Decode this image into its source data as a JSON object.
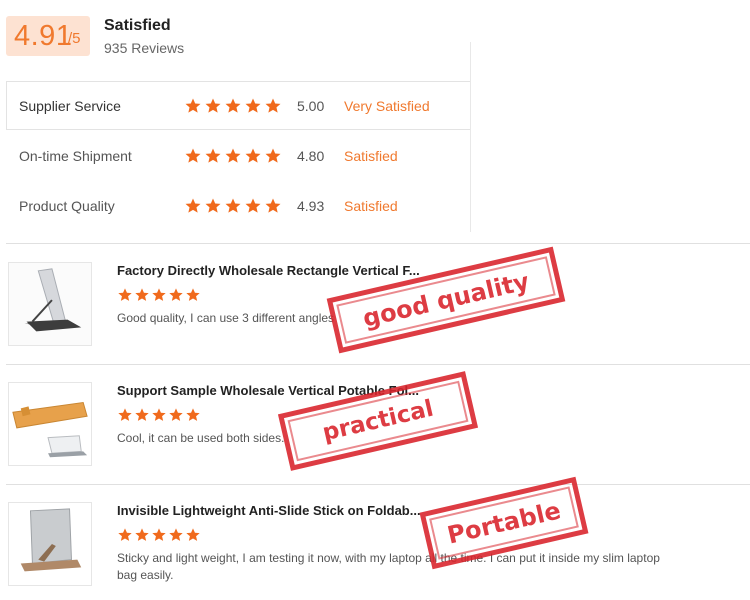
{
  "summary": {
    "score": "4.91",
    "score_suffix": "/5",
    "label": "Satisfied",
    "review_count": "935 Reviews"
  },
  "ratings": [
    {
      "label": "Supplier Service",
      "stars": 5,
      "score": "5.00",
      "status": "Very Satisfied"
    },
    {
      "label": "On-time Shipment",
      "stars": 5,
      "score": "4.80",
      "status": "Satisfied"
    },
    {
      "label": "Product Quality",
      "stars": 5,
      "score": "4.93",
      "status": "Satisfied"
    }
  ],
  "reviews": [
    {
      "title": "Factory Directly Wholesale Rectangle Vertical F...",
      "stars": 5,
      "text": "Good quality, I can use 3 different angles",
      "stamp": "good quality"
    },
    {
      "title": "Support Sample Wholesale Vertical Potable Fol...",
      "stars": 5,
      "text": "Cool, it can be used both sides.",
      "stamp": "practical"
    },
    {
      "title": "Invisible Lightweight Anti-Slide Stick on Foldab...",
      "stars": 5,
      "text": "Sticky and light weight, I am testing it now, with my laptop all the time. I can put it inside my slim laptop bag easily.",
      "stamp": "Portable"
    }
  ],
  "colors": {
    "accent": "#f0792e",
    "star": "#f06a1c",
    "stamp": "#d9222a",
    "score_bg": "#fde2d2"
  },
  "icons": {
    "star": "star-icon"
  }
}
